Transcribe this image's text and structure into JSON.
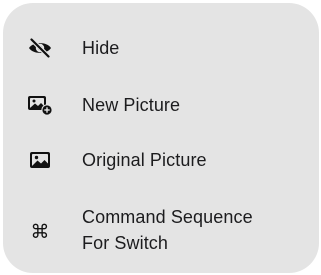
{
  "menu": {
    "items": [
      {
        "label": "Hide",
        "icon": "eye-slash-icon"
      },
      {
        "label": "New Picture",
        "icon": "photo-badge-plus-icon"
      },
      {
        "label": "Original Picture",
        "icon": "photo-icon"
      },
      {
        "label_line1": "Command Sequence",
        "label_line2": "For Switch",
        "icon": "command-key-icon",
        "glyph": "⌘"
      }
    ]
  }
}
